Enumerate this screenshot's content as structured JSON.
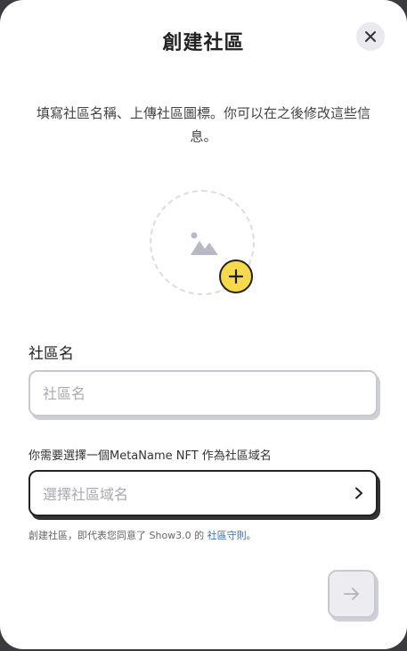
{
  "dialog": {
    "title": "創建社區",
    "intro": "填寫社區名稱、上傳社區圖標。你可以在之後修改這些信息。",
    "close_icon": "close-icon"
  },
  "avatar": {
    "image_icon": "image-icon",
    "add_icon": "plus-icon"
  },
  "name_field": {
    "label": "社區名",
    "placeholder": "社區名",
    "value": ""
  },
  "domain_field": {
    "label": "你需要選擇一個MetaName NFT 作為社區域名",
    "placeholder": "選擇社區域名",
    "chevron_icon": "chevron-right-icon"
  },
  "terms": {
    "prefix": "創建社區，即代表您同意了 Show3.0 的",
    "link": "社區守則",
    "suffix": "。"
  },
  "next_button": {
    "icon": "arrow-right-icon",
    "enabled": false
  },
  "colors": {
    "accent_yellow": "#f7d94c",
    "link_blue": "#3b6fa8",
    "disabled_gray": "#ececf1"
  }
}
